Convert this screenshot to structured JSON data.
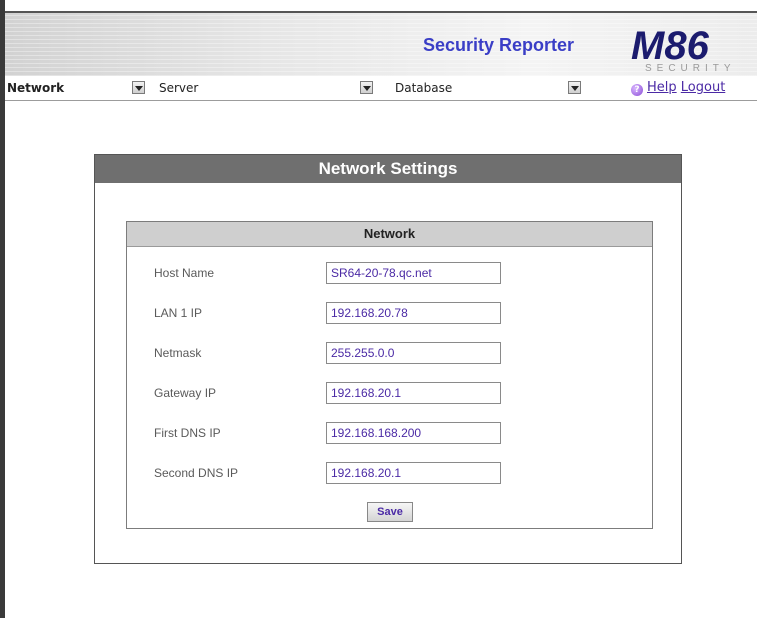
{
  "app": {
    "title": "Security Reporter",
    "logo_text": "M86",
    "logo_sub": "SECURITY"
  },
  "menubar": {
    "menus": [
      {
        "label": "Network"
      },
      {
        "label": "Server"
      },
      {
        "label": "Database"
      }
    ],
    "help_label": "Help",
    "logout_label": "Logout"
  },
  "panel": {
    "title": "Network Settings",
    "section_title": "Network",
    "fields": [
      {
        "label": "Host Name",
        "value": "SR64-20-78.qc.net"
      },
      {
        "label": "LAN 1 IP",
        "value": "192.168.20.78"
      },
      {
        "label": "Netmask",
        "value": "255.255.0.0"
      },
      {
        "label": "Gateway IP",
        "value": "192.168.20.1"
      },
      {
        "label": "First DNS IP",
        "value": "192.168.168.200"
      },
      {
        "label": "Second DNS IP",
        "value": "192.168.20.1"
      }
    ],
    "save_label": "Save"
  },
  "colors": {
    "accent": "#3a3ec6",
    "link": "#4b2aa5",
    "panel_header": "#6f6f6f"
  }
}
